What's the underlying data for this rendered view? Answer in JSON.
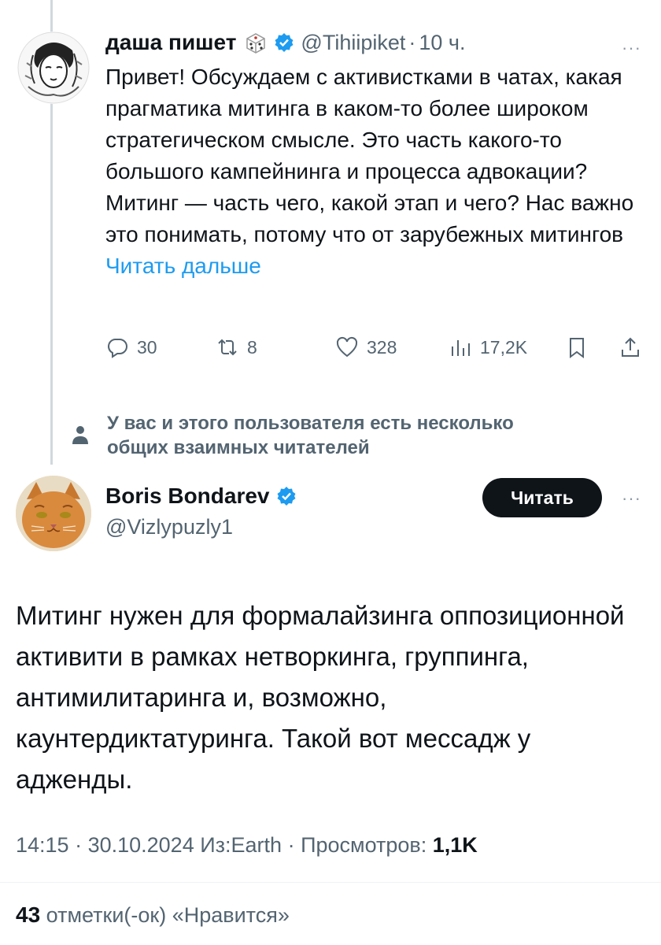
{
  "tweet1": {
    "author_name": "даша пишет",
    "handle": "@Tihiipiket",
    "separator": "·",
    "time": "10 ч.",
    "more": "···",
    "text": "Привет! Обсуждаем с активистками в чатах, какая прагматика митинга в каком-то более широком стратегическом смысле. Это часть какого-то большого кампейнинга и процесса адвокации? Митинг — часть чего, какой этап и чего? Нас важно это понимать, потому что от зарубежных митингов",
    "read_more": "Читать дальше",
    "actions": {
      "replies": "30",
      "retweets": "8",
      "likes": "328",
      "views": "17,2K"
    }
  },
  "mutual_notice": {
    "line1": "У вас и этого пользователя есть несколько",
    "line2": "общих взаимных читателей"
  },
  "tweet2": {
    "author_name": "Boris Bondarev",
    "handle": "@Vizlypuzly1",
    "follow_label": "Читать",
    "more": "···",
    "text": "Митинг нужен для формалайзинга оппозиционной активити в рамках нетворкинга, группинга, антимилитаринга и, возможно, каунтердиктатуринга. Такой вот мессадж у адженды.",
    "meta": {
      "time": "14:15",
      "date": "30.10.2024",
      "source": "Из:Earth",
      "views_label": "Просмотров:",
      "views_value": "1,1K"
    },
    "likes_count": "43",
    "likes_label": "отметки(-ок) «Нравится»"
  },
  "colors": {
    "accent": "#1d9bf0",
    "text": "#0f1419",
    "secondary": "#536471"
  }
}
